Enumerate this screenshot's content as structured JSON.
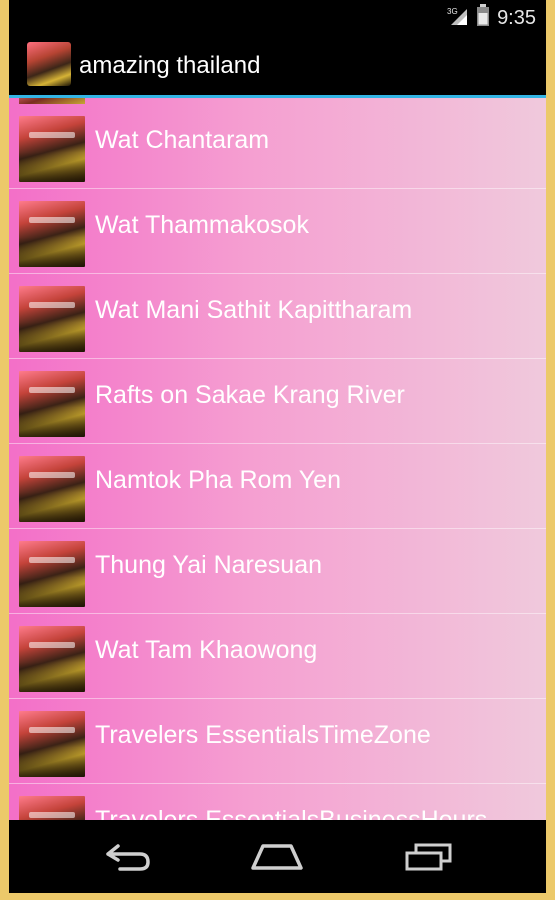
{
  "status": {
    "network": "3G",
    "time": "9:35"
  },
  "app": {
    "title": "amazing thailand",
    "icon": "app-icon"
  },
  "list": {
    "items": [
      {
        "label": "Wat Chantaram",
        "icon": "thumbnail-image"
      },
      {
        "label": "Wat Thammakosok",
        "icon": "thumbnail-image"
      },
      {
        "label": "Wat Mani Sathit Kapittharam",
        "icon": "thumbnail-image"
      },
      {
        "label": "Rafts on Sakae Krang River",
        "icon": "thumbnail-image"
      },
      {
        "label": "Namtok Pha Rom Yen",
        "icon": "thumbnail-image"
      },
      {
        "label": "Thung Yai Naresuan",
        "icon": "thumbnail-image"
      },
      {
        "label": "Wat Tam Khaowong",
        "icon": "thumbnail-image"
      },
      {
        "label": "Travelers EssentialsTimeZone",
        "icon": "thumbnail-image"
      },
      {
        "label": "Travelers EssentialsBusinessHours",
        "icon": "thumbnail-image"
      }
    ]
  },
  "navbar": {
    "back": "back-icon",
    "home": "home-icon",
    "recents": "recents-icon"
  },
  "colors": {
    "accent": "#33b5e5",
    "list_gradient_left": "#f36fc8",
    "list_gradient_right": "#f0c9dc",
    "outer_frame": "#ecc96a"
  }
}
